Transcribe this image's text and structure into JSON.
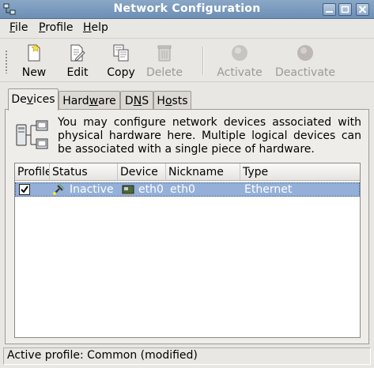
{
  "window": {
    "title": "Network Configuration"
  },
  "menubar": {
    "items": [
      {
        "pre": "",
        "accel": "F",
        "post": "ile"
      },
      {
        "pre": "",
        "accel": "P",
        "post": "rofile"
      },
      {
        "pre": "",
        "accel": "H",
        "post": "elp"
      }
    ]
  },
  "toolbar": {
    "new_label": "New",
    "edit_label": "Edit",
    "copy_label": "Copy",
    "delete_label": "Delete",
    "activate_label": "Activate",
    "deactivate_label": "Deactivate"
  },
  "tabs": [
    {
      "pre": "De",
      "accel": "v",
      "post": "ices"
    },
    {
      "pre": "Hard",
      "accel": "w",
      "post": "are"
    },
    {
      "pre": "D",
      "accel": "N",
      "post": "S"
    },
    {
      "pre": "H",
      "accel": "o",
      "post": "sts"
    }
  ],
  "info": {
    "text": "You may configure network devices associated with physical hardware here. Multiple logical devices can be associated with a single piece of hardware."
  },
  "list": {
    "columns": [
      "Profile",
      "Status",
      "Device",
      "Nickname",
      "Type"
    ],
    "rows": [
      {
        "profile_checked": true,
        "status": "Inactive",
        "device": "eth0",
        "nickname": "eth0",
        "type": "Ethernet"
      }
    ]
  },
  "statusbar": {
    "text": "Active profile: Common (modified)"
  },
  "colors": {
    "titlebar": "#7b9bc0",
    "selection": "#94b0d8",
    "background": "#e9e7e3"
  }
}
